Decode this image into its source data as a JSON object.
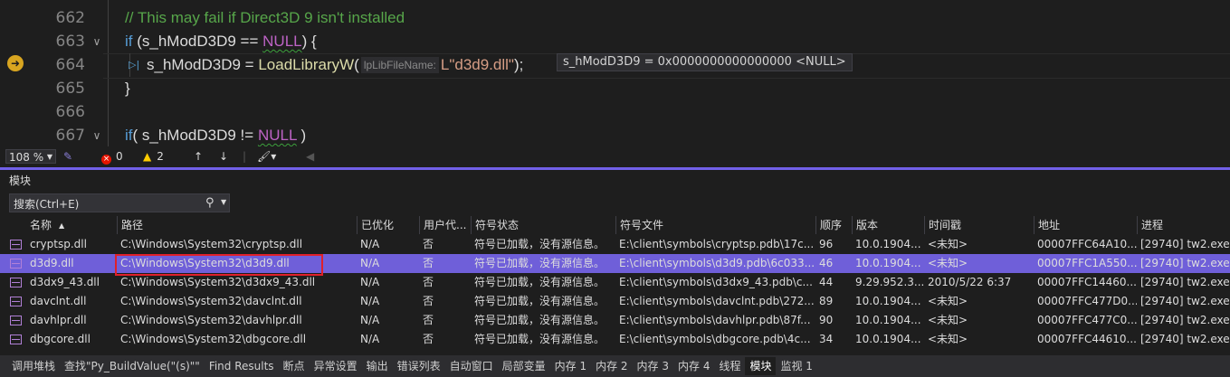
{
  "editor": {
    "lines": [
      {
        "num": "662",
        "fold": "",
        "segments": [
          {
            "t": "// This may fail if Direct3D 9 isn't installed",
            "c": "cm"
          }
        ]
      },
      {
        "num": "663",
        "fold": "∨",
        "segments": [
          {
            "t": "if",
            "c": "kw"
          },
          {
            "t": " (s_hModD3D9 == ",
            "c": "id"
          },
          {
            "t": "NULL",
            "c": "mac squig"
          },
          {
            "t": ") {",
            "c": "id"
          }
        ]
      },
      {
        "num": "664",
        "fold": "",
        "current": true,
        "segments": [
          {
            "t": "s_hModD3D9 = ",
            "c": "id"
          },
          {
            "t": "LoadLibraryW",
            "c": "fn"
          },
          {
            "t": "(",
            "c": "id"
          },
          {
            "hint": "lpLibFileName:"
          },
          {
            "t": "L\"d3d9.dll\"",
            "c": "str"
          },
          {
            "t": ");",
            "c": "id"
          }
        ]
      },
      {
        "num": "665",
        "fold": "",
        "segments": [
          {
            "t": "}",
            "c": "id"
          }
        ]
      },
      {
        "num": "666",
        "fold": "",
        "segments": []
      },
      {
        "num": "667",
        "fold": "∨",
        "segments": [
          {
            "t": "if",
            "c": "kw"
          },
          {
            "t": "( s_hModD3D9 != ",
            "c": "id"
          },
          {
            "t": "NULL",
            "c": "mac squig"
          },
          {
            "t": " )",
            "c": "id"
          }
        ]
      }
    ],
    "datatip": "s_hModD3D9 = 0x0000000000000000 <NULL>",
    "status": {
      "zoom": "108 %",
      "errors": "0",
      "warnings": "2"
    }
  },
  "modules_panel": {
    "title": "模块",
    "search_placeholder": "搜索(Ctrl+E)",
    "columns": [
      "名称",
      "路径",
      "已优化",
      "用户代...",
      "符号状态",
      "符号文件",
      "顺序",
      "版本",
      "时间戳",
      "地址",
      "进程"
    ],
    "rows": [
      [
        "cryptsp.dll",
        "C:\\Windows\\System32\\cryptsp.dll",
        "N/A",
        "否",
        "符号已加载，没有源信息。",
        "E:\\client\\symbols\\cryptsp.pdb\\17c...",
        "96",
        "10.0.1904...",
        "<未知>",
        "00007FFC64A10...",
        "[29740] tw2.exe"
      ],
      [
        "d3d9.dll",
        "C:\\Windows\\System32\\d3d9.dll",
        "N/A",
        "否",
        "符号已加载，没有源信息。",
        "E:\\client\\symbols\\d3d9.pdb\\6c033...",
        "46",
        "10.0.1904...",
        "<未知>",
        "00007FFC1A550...",
        "[29740] tw2.exe"
      ],
      [
        "d3dx9_43.dll",
        "C:\\Windows\\System32\\d3dx9_43.dll",
        "N/A",
        "否",
        "符号已加载，没有源信息。",
        "E:\\client\\symbols\\d3dx9_43.pdb\\c...",
        "44",
        "9.29.952.3...",
        "2010/5/22 6:37",
        "00007FFC14460...",
        "[29740] tw2.exe"
      ],
      [
        "davclnt.dll",
        "C:\\Windows\\System32\\davclnt.dll",
        "N/A",
        "否",
        "符号已加载，没有源信息。",
        "E:\\client\\symbols\\davclnt.pdb\\272...",
        "89",
        "10.0.1904...",
        "<未知>",
        "00007FFC477D0...",
        "[29740] tw2.exe"
      ],
      [
        "davhlpr.dll",
        "C:\\Windows\\System32\\davhlpr.dll",
        "N/A",
        "否",
        "符号已加载，没有源信息。",
        "E:\\client\\symbols\\davhlpr.pdb\\87f...",
        "90",
        "10.0.1904...",
        "<未知>",
        "00007FFC477C0...",
        "[29740] tw2.exe"
      ],
      [
        "dbgcore.dll",
        "C:\\Windows\\System32\\dbgcore.dll",
        "N/A",
        "否",
        "符号已加载，没有源信息。",
        "E:\\client\\symbols\\dbgcore.pdb\\4c...",
        "34",
        "10.0.1904...",
        "<未知>",
        "00007FFC44610...",
        "[29740] tw2.exe"
      ]
    ],
    "selected_row": 1
  },
  "bottom_tabs": [
    {
      "label": "调用堆栈",
      "active": false
    },
    {
      "label": "查找\"Py_BuildValue(\"(s)\"\"",
      "active": false
    },
    {
      "label": "Find Results",
      "active": false
    },
    {
      "label": "断点",
      "active": false
    },
    {
      "label": "异常设置",
      "active": false
    },
    {
      "label": "输出",
      "active": false
    },
    {
      "label": "错误列表",
      "active": false
    },
    {
      "label": "自动窗口",
      "active": false
    },
    {
      "label": "局部变量",
      "active": false
    },
    {
      "label": "内存 1",
      "active": false
    },
    {
      "label": "内存 2",
      "active": false
    },
    {
      "label": "内存 3",
      "active": false
    },
    {
      "label": "内存 4",
      "active": false
    },
    {
      "label": "线程",
      "active": false
    },
    {
      "label": "模块",
      "active": true
    },
    {
      "label": "监视 1",
      "active": false
    }
  ],
  "colors": {
    "accent": "#6f5fd9",
    "highlight_box": "#e0202a"
  }
}
